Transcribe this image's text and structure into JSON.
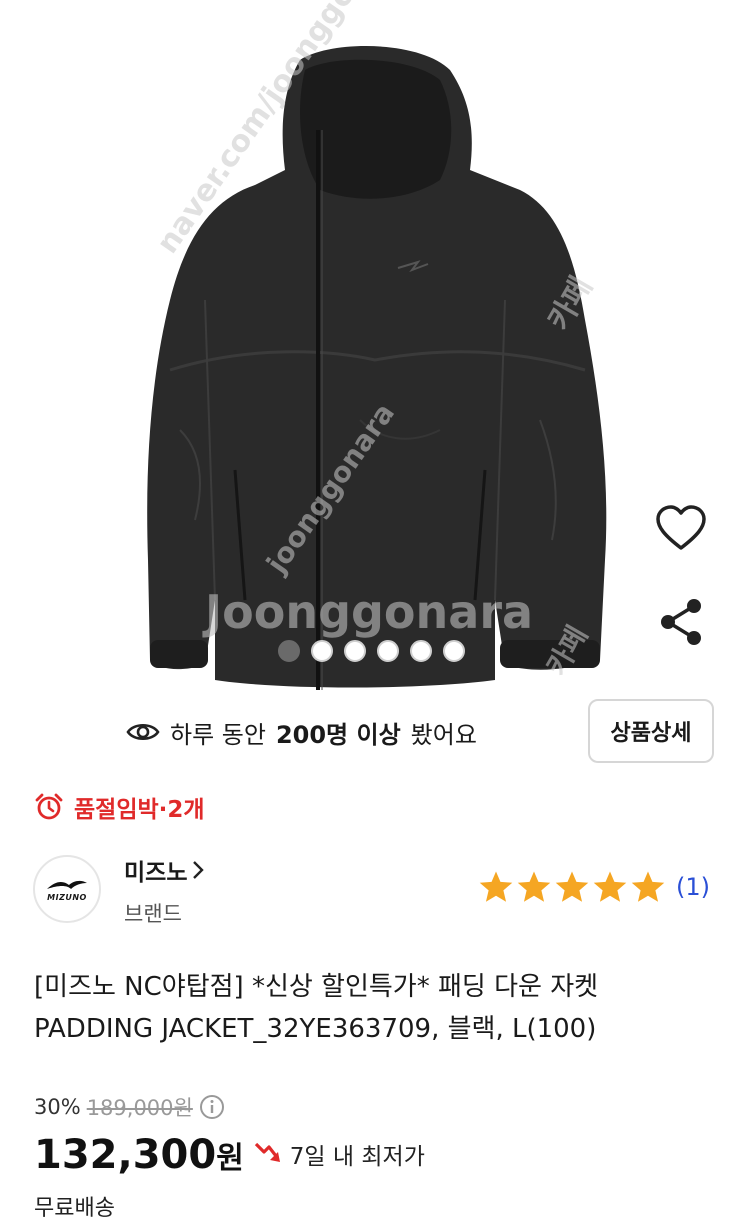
{
  "hero": {
    "watermarks": [
      "naver.com/joonggonara",
      "카페",
      "Joonggonara",
      "joonggonara",
      "카페"
    ],
    "carousel": {
      "count": 6,
      "active_index": 0
    }
  },
  "actions": {
    "like_icon": "heart-icon",
    "share_icon": "share-icon"
  },
  "views": {
    "prefix": "하루 동안",
    "count": "200명 이상",
    "suffix": "봤어요"
  },
  "detail_button": "상품상세",
  "stock": {
    "label": "품절임박·2개",
    "color": "#e02a2a"
  },
  "brand": {
    "logo_text": "MIZUNO",
    "name": "미즈노",
    "type": "브랜드"
  },
  "rating": {
    "stars": 5,
    "count": "(1)",
    "star_color": "#f5a623"
  },
  "product": {
    "title_line1": "[미즈노 NC야탑점] *신상 할인특가* 패딩 다운 자켓",
    "title_line2": "PADDING JACKET_32YE363709, 블랙, L(100)"
  },
  "price": {
    "discount": "30%",
    "original": "189,000원",
    "current": "132,300",
    "unit": "원",
    "lowest_label": "7일 내 최저가",
    "shipping": "무료배송"
  }
}
